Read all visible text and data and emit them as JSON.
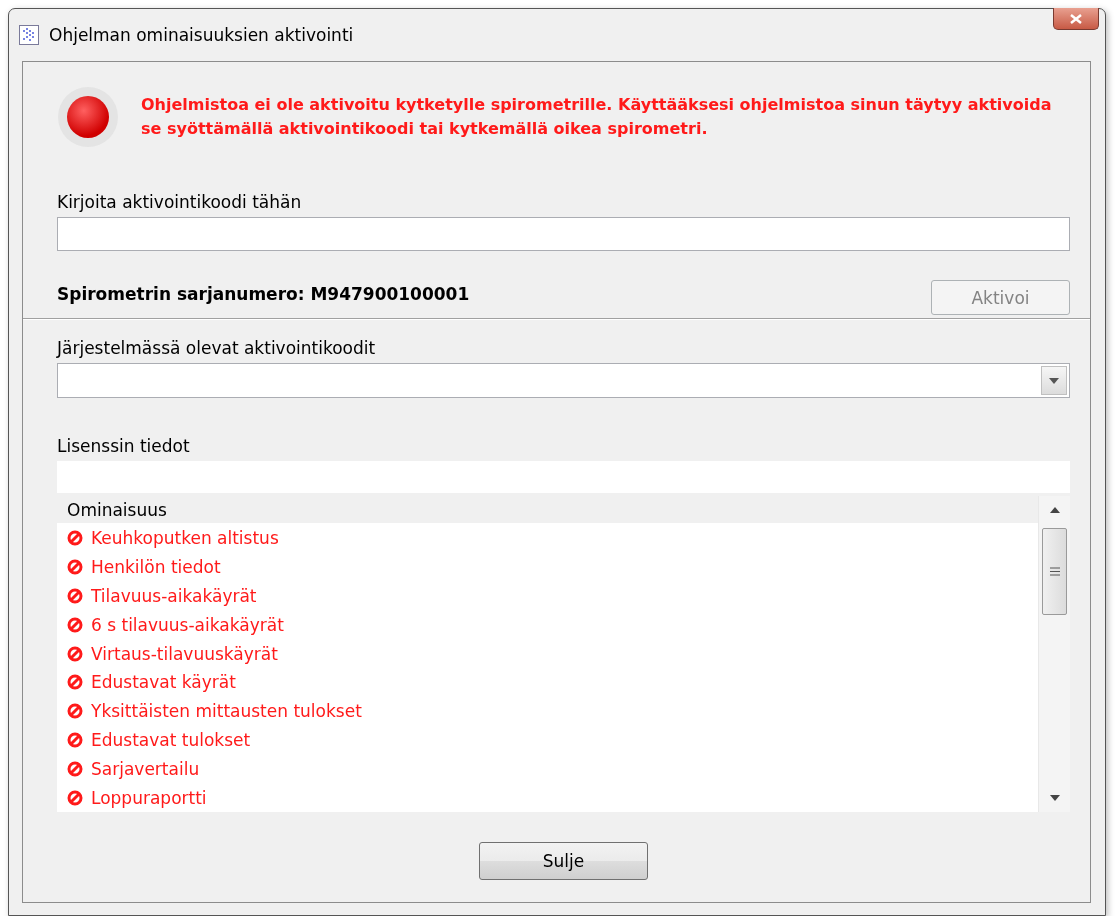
{
  "window": {
    "title": "Ohjelman ominaisuuksien aktivointi"
  },
  "status": {
    "message": "Ohjelmistoa ei ole aktivoitu kytketylle spirometrille. Käyttääksesi ohjelmistoa sinun täytyy aktivoida se syöttämällä aktivointikoodi tai kytkemällä oikea spirometri.",
    "activated": false
  },
  "code_field": {
    "label": "Kirjoita aktivointikoodi tähän"
  },
  "activate_button": {
    "label": "Aktivoi",
    "disabled": true
  },
  "serial": {
    "text": "Spirometrin sarjanumero: M947900100001"
  },
  "codes_combo": {
    "label": "Järjestelmässä olevat aktivointikoodit"
  },
  "license": {
    "label": "Lisenssin tiedot",
    "column": "Ominaisuus",
    "features": [
      {
        "name": "Keuhkoputken altistus",
        "enabled": false
      },
      {
        "name": "Henkilön tiedot",
        "enabled": false
      },
      {
        "name": "Tilavuus-aikakäyrät",
        "enabled": false
      },
      {
        "name": "6 s tilavuus-aikakäyrät",
        "enabled": false
      },
      {
        "name": "Virtaus-tilavuuskäyrät",
        "enabled": false
      },
      {
        "name": "Edustavat käyrät",
        "enabled": false
      },
      {
        "name": "Yksittäisten mittausten tulokset",
        "enabled": false
      },
      {
        "name": "Edustavat tulokset",
        "enabled": false
      },
      {
        "name": "Sarjavertailu",
        "enabled": false
      },
      {
        "name": "Loppuraportti",
        "enabled": false
      }
    ]
  },
  "close_button": {
    "label": "Sulje"
  }
}
